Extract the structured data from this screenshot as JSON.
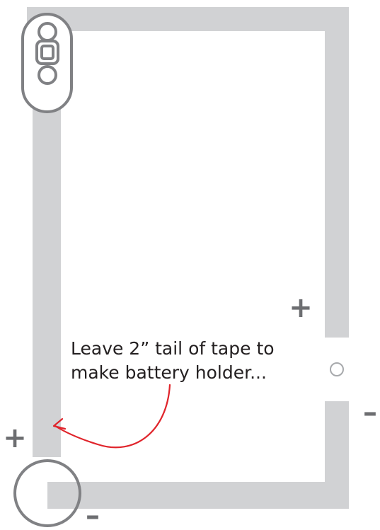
{
  "annotation": {
    "line1": "Leave 2” tail of tape to",
    "line2": "make battery holder..."
  },
  "polarity": {
    "plus": "+",
    "minus": "–"
  },
  "colors": {
    "tape": "#d1d2d4",
    "component_outline": "#808184",
    "symbol": "#6d6e71",
    "arrow": "#e0242b",
    "text": "#231f20",
    "led_pad": "#a7a9ac"
  },
  "icons": {
    "switch": "slide-switch-icon",
    "battery": "coin-cell-battery-icon",
    "led": "led-icon",
    "arrow": "curved-arrow-icon"
  }
}
